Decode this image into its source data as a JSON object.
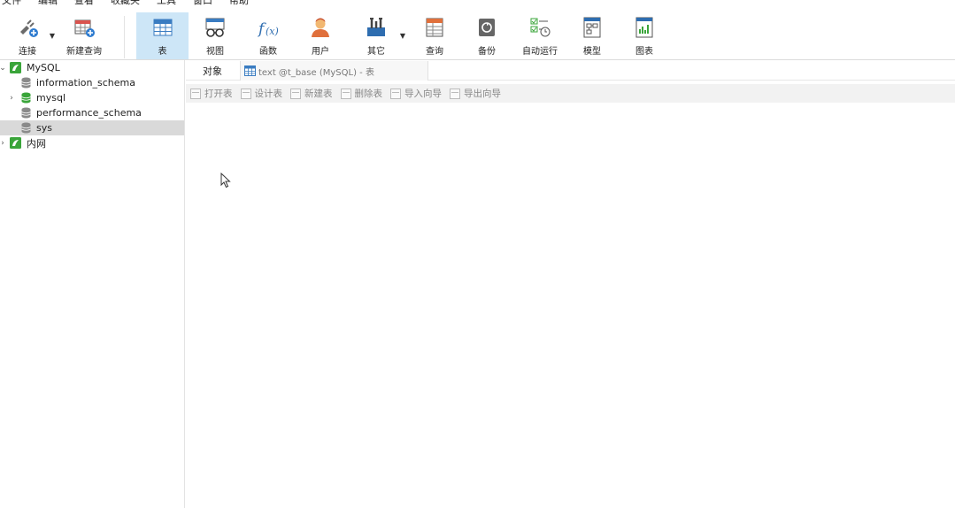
{
  "menu": [
    "文件",
    "编辑",
    "查看",
    "收藏夹",
    "工具",
    "窗口",
    "帮助"
  ],
  "toolbar": {
    "connect": "连接",
    "new_query": "新建查询",
    "table": "表",
    "view": "视图",
    "function": "函数",
    "user": "用户",
    "other": "其它",
    "query": "查询",
    "backup": "备份",
    "auto_run": "自动运行",
    "model": "模型",
    "chart": "图表"
  },
  "sidebar": {
    "connections": [
      {
        "label": "MySQL",
        "expanded": true,
        "databases": [
          "information_schema",
          "mysql",
          "performance_schema",
          "sys"
        ],
        "selected": "sys"
      },
      {
        "label": "内网",
        "expanded": false
      }
    ]
  },
  "tabs": {
    "objects": "对象",
    "open_tab": "text @t_base (MySQL) - 表"
  },
  "actions": [
    "打开表",
    "设计表",
    "新建表",
    "删除表",
    "导入向导",
    "导出向导"
  ],
  "colors": {
    "active_tool": "#cde6f7",
    "selected_row": "#d9d9d9",
    "mysql_green": "#3aa53a"
  }
}
